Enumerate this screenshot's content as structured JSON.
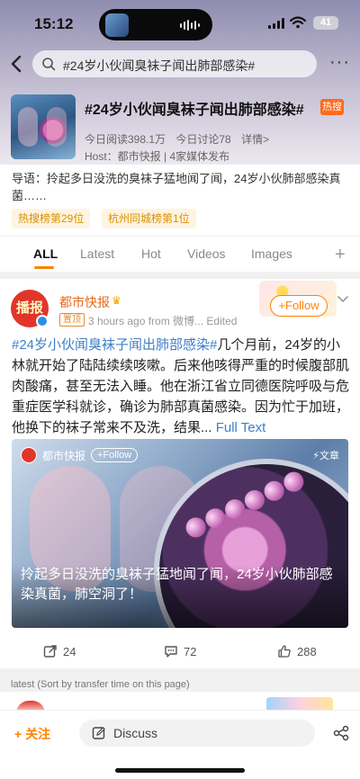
{
  "status": {
    "time": "15:12",
    "battery": "41"
  },
  "search": {
    "query": "#24岁小伙闻臭袜子闻出肺部感染#"
  },
  "topic": {
    "title": "#24岁小伙闻臭袜子闻出肺部感染#",
    "hot_badge": "热搜",
    "reads": "今日阅读398.1万",
    "discussions": "今日讨论78",
    "details": "详情>",
    "host": "Host：都市快报 | 4家媒体发布",
    "intro": "导语：拎起多日没洗的臭袜子猛地闻了闻，24岁小伙肺部感染真菌……",
    "tags": [
      "热搜榜第29位",
      "杭州同城榜第1位"
    ]
  },
  "tabs": [
    "ALL",
    "Latest",
    "Hot",
    "Videos",
    "Images"
  ],
  "post": {
    "avatar_text": "播报",
    "author": "都市快报",
    "pin_label": "置顶",
    "meta": "3 hours ago  from 微博...  Edited",
    "follow_label": "+Follow",
    "hashtag": "#24岁小伙闻臭袜子闻出肺部感染#",
    "body": "几个月前，24岁的小林就开始了陆陆续续咳嗽。后来他咳得严重的时候腹部肌肉酸痛，甚至无法入睡。他在浙江省立同德医院呼吸与危重症医学科就诊，确诊为肺部真菌感染。因为忙于加班，他换下的袜子常来不及洗，结果...",
    "more_label": "Full Text",
    "media": {
      "author": "都市快报",
      "follow_label": "+Follow",
      "article_label": "文章",
      "caption": "拎起多日没洗的臭袜子猛地闻了闻，24岁小伙肺部感染真菌，肺空洞了！"
    },
    "actions": {
      "reposts": "24",
      "comments": "72",
      "likes": "288"
    }
  },
  "latest_hint": "latest (Sort by transfer time on this page)",
  "bottom": {
    "follow_label": "关注",
    "discuss_label": "Discuss"
  },
  "colors": {
    "accent": "#ff8200",
    "link": "#3f7ec7",
    "author": "#e86a1a"
  }
}
